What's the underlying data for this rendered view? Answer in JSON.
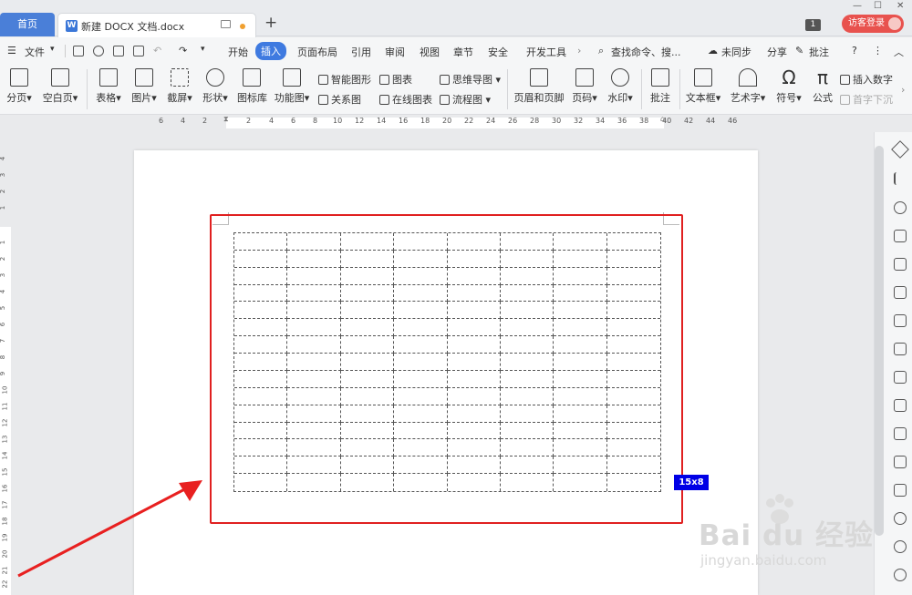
{
  "tabbar": {
    "home": "首页",
    "doc_icon": "W",
    "doc_name": "新建 DOCX 文档.docx",
    "new_tab": "+",
    "window_count": "1",
    "login": "访客登录"
  },
  "menubar": {
    "file": "文件",
    "items": [
      "开始",
      "插入",
      "页面布局",
      "引用",
      "审阅",
      "视图",
      "章节",
      "安全",
      "开发工具"
    ],
    "active": "插入",
    "search": "查找命令、搜...",
    "sync": "未同步",
    "share": "分享",
    "comment": "批注",
    "help": "?"
  },
  "ribbon": {
    "page_break": "分页",
    "blank_page": "空白页",
    "table": "表格",
    "picture": "图片",
    "screenshot": "截屏",
    "shape": "形状",
    "icon_lib": "图标库",
    "func_chart": "功能图",
    "smart_shape": "智能图形",
    "chart": "图表",
    "mindmap": "思维导图",
    "relation": "关系图",
    "online_chart": "在线图表",
    "flowchart": "流程图",
    "header_footer": "页眉和页脚",
    "page_num": "页码",
    "watermark": "水印",
    "annotate": "批注",
    "textbox": "文本框",
    "wordart": "艺术字",
    "symbol": "符号",
    "formula": "公式",
    "insert_number": "插入数字",
    "dropcap": "首字下沉"
  },
  "ruler": {
    "h_ticks": [
      "6",
      "4",
      "2",
      "2",
      "4",
      "6",
      "8",
      "10",
      "12",
      "14",
      "16",
      "18",
      "20",
      "22",
      "24",
      "26",
      "28",
      "30",
      "32",
      "34",
      "36",
      "38",
      "40",
      "42",
      "44",
      "46"
    ],
    "v_ticks": [
      "4",
      "3",
      "2",
      "1",
      "1",
      "2",
      "3",
      "4",
      "5",
      "6",
      "7",
      "8",
      "9",
      "10",
      "11",
      "12",
      "13",
      "14",
      "15",
      "16",
      "17",
      "18",
      "19",
      "20",
      "21",
      "22"
    ]
  },
  "document": {
    "table_size_badge": "15x8"
  },
  "watermark": {
    "main": "Bai du 经验",
    "url": "jingyan.baidu.com"
  }
}
